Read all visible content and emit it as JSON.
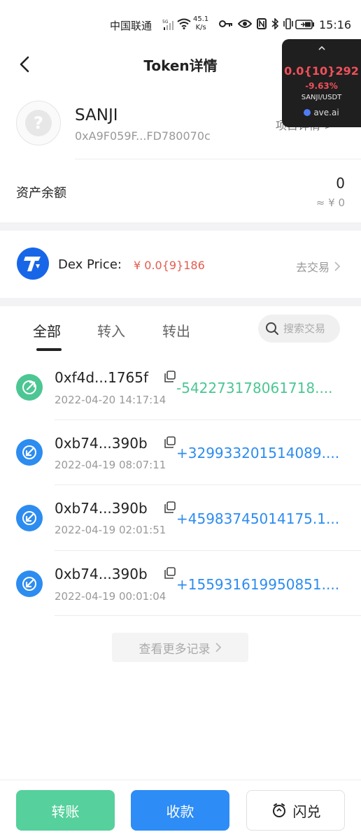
{
  "status_bar": {
    "carrier": "中国联通",
    "network": "5G",
    "speed_value": "45.1",
    "speed_unit": "K/s",
    "time": "15:16",
    "icons": [
      "key-icon",
      "eye-icon",
      "nfc-icon",
      "bluetooth-icon",
      "vibrate-icon",
      "battery-icon"
    ]
  },
  "header": {
    "title": "Token详情"
  },
  "price_widget": {
    "price": "0.0{10}292",
    "change": "-9.63%",
    "pair": "SANJI/USDT",
    "brand": "ave.ai"
  },
  "token": {
    "name": "SANJI",
    "address": "0xA9F059F...FD780070c",
    "project_link": "项目详情 >"
  },
  "balance": {
    "label": "资产余额",
    "amount": "0",
    "fiat": "≈ ¥  0"
  },
  "dex": {
    "label": "Dex Price:",
    "price": "¥ 0.0{9}186",
    "trade_link": "去交易"
  },
  "tabs": [
    {
      "label": "全部",
      "active": true
    },
    {
      "label": "转入",
      "active": false
    },
    {
      "label": "转出",
      "active": false
    }
  ],
  "search": {
    "placeholder": "搜索交易"
  },
  "transactions": [
    {
      "hash": "0xf4d...1765f",
      "date": "2022-04-20 14:17:14",
      "amount": "-542273178061718....",
      "direction": "out"
    },
    {
      "hash": "0xb74...390b",
      "date": "2022-04-19 08:07:11",
      "amount": "+329933201514089....",
      "direction": "in"
    },
    {
      "hash": "0xb74...390b",
      "date": "2022-04-19 02:01:51",
      "amount": "+45983745014175.1...",
      "direction": "in"
    },
    {
      "hash": "0xb74...390b",
      "date": "2022-04-19 00:01:04",
      "amount": "+155931619950851....",
      "direction": "in"
    }
  ],
  "more_records": "查看更多记录",
  "bottom_bar": {
    "transfer": "转账",
    "receive": "收款",
    "swap": "闪兑"
  },
  "colors": {
    "out": "#4cc693",
    "in": "#2c8cf0",
    "price_red": "#e45a4f",
    "transfer_green": "#56d09c",
    "receive_blue": "#2d8cf5"
  }
}
